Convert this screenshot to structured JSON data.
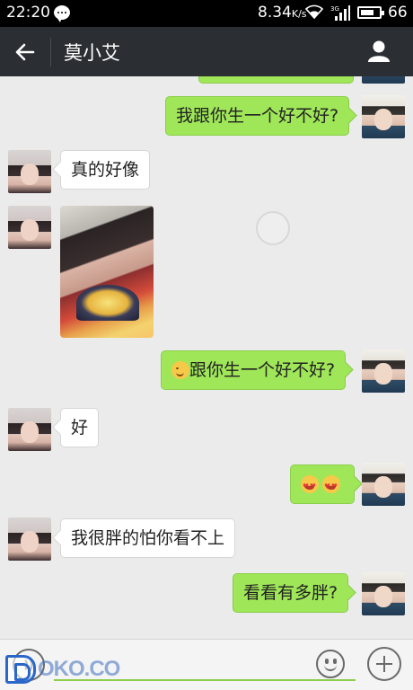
{
  "status_bar": {
    "time": "22:20",
    "network_speed": "8.34",
    "network_unit": "K/s",
    "signal_label": "3G",
    "battery": "66",
    "icons": [
      "message-icon",
      "wifi-icon",
      "signal-icon",
      "battery-icon"
    ]
  },
  "header": {
    "title": "莫小艾",
    "back_icon": "back-arrow-icon",
    "contact_icon": "person-icon"
  },
  "messages": [
    {
      "direction": "out",
      "type": "text",
      "text": "我跟你生一个好不好?"
    },
    {
      "direction": "in",
      "type": "text",
      "text": "真的好像"
    },
    {
      "direction": "in",
      "type": "image",
      "description": "selfie photo"
    },
    {
      "direction": "out",
      "type": "text",
      "emoji": "winking-face-emoji",
      "text": "跟你生一个好不好?"
    },
    {
      "direction": "in",
      "type": "text",
      "text": "好"
    },
    {
      "direction": "out",
      "type": "emoji",
      "emoji": [
        "heart-eyes-emoji",
        "heart-eyes-emoji"
      ]
    },
    {
      "direction": "in",
      "type": "text",
      "text": "我很胖的怕你看不上"
    },
    {
      "direction": "out",
      "type": "text",
      "text": "看看有多胖?"
    }
  ],
  "input_bar": {
    "value": "",
    "icons": [
      "voice-icon",
      "emoji-icon",
      "plus-icon"
    ]
  },
  "watermark": {
    "text": "OKO.CO"
  },
  "colors": {
    "outgoing_bubble": "#9fe658",
    "incoming_bubble": "#ffffff",
    "title_bar": "#2b2f33",
    "chat_background": "#ebebeb",
    "input_underline": "#8ccd4b"
  }
}
